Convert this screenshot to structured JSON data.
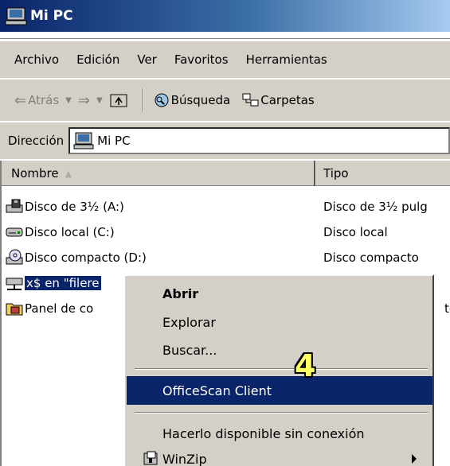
{
  "window": {
    "title": "Mi PC"
  },
  "menubar": {
    "items": [
      "Archivo",
      "Edición",
      "Ver",
      "Favoritos",
      "Herramientas"
    ]
  },
  "toolbar": {
    "back": "Atrás",
    "search": "Búsqueda",
    "folders": "Carpetas"
  },
  "address": {
    "label": "Dirección",
    "value": "Mi PC"
  },
  "columns": {
    "name": "Nombre",
    "type": "Tipo"
  },
  "rows": [
    {
      "name": "Disco de 3½ (A:)",
      "type": "Disco de 3½ pulg",
      "icon": "floppy-drive-icon"
    },
    {
      "name": "Disco local (C:)",
      "type": "Disco local",
      "icon": "hard-drive-icon"
    },
    {
      "name": "Disco compacto (D:)",
      "type": "Disco compacto",
      "icon": "cd-drive-icon"
    },
    {
      "name": "x$ en \"filere",
      "type": "",
      "icon": "network-drive-icon"
    },
    {
      "name": "Panel de co",
      "type": "te",
      "icon": "control-panel-icon"
    }
  ],
  "context_menu": {
    "items": [
      "Abrir",
      "Explorar",
      "Buscar...",
      "OfficeScan Client",
      "Hacerlo disponible sin conexión",
      "WinZip"
    ]
  },
  "annotation": {
    "label": "4"
  },
  "colors": {
    "selection": "#0a246a",
    "face": "#d4d0c8",
    "badge": "#ffff66"
  }
}
